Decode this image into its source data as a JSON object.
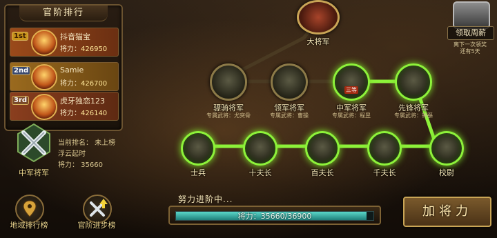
{
  "rank_panel": {
    "title": "官阶排行",
    "entries": [
      {
        "place": "1st",
        "name": "抖音猫宝",
        "power_label": "将力：",
        "power": "426950"
      },
      {
        "place": "2nd",
        "name": "Samie",
        "power_label": "将力：",
        "power": "426700"
      },
      {
        "place": "3rd",
        "name": "虎牙独恋123",
        "power_label": "将力：",
        "power": "426140"
      }
    ]
  },
  "my_status": {
    "rank_text": "当前排名： 未上榜",
    "name": "浮云起时",
    "power_text": "将力： 35660",
    "title": "中军将军"
  },
  "bottom_left_buttons": [
    {
      "label": "地域排行榜",
      "icon": "map-pin-icon"
    },
    {
      "label": "官阶进步榜",
      "icon": "crossed-swords-up-icon"
    }
  ],
  "weekly_reward": {
    "button": "领取周薪",
    "note_line1": "离下一次领奖",
    "note_line2": "还有5天"
  },
  "tree": {
    "top": {
      "label": "大将军"
    },
    "row2": [
      {
        "label": "骠骑将军",
        "sub": "专属武将：尤突骨"
      },
      {
        "label": "领军将军",
        "sub": "专属武将：曹操"
      },
      {
        "label": "中军将军",
        "sub": "专属武将：程昱",
        "mark": "三等"
      },
      {
        "label": "先锋将军",
        "sub": "专属武将：钟繇"
      }
    ],
    "row3": [
      {
        "label": "士兵"
      },
      {
        "label": "十夫长"
      },
      {
        "label": "百夫长"
      },
      {
        "label": "千夫长"
      },
      {
        "label": "校尉"
      }
    ]
  },
  "progress": {
    "title": "努力进阶中...",
    "text": "将力：35660/36900",
    "current": 35660,
    "max": 36900
  },
  "add_button": {
    "label": "加将力"
  },
  "colors": {
    "lit": "#8df23a",
    "gold": "#c9a556"
  }
}
